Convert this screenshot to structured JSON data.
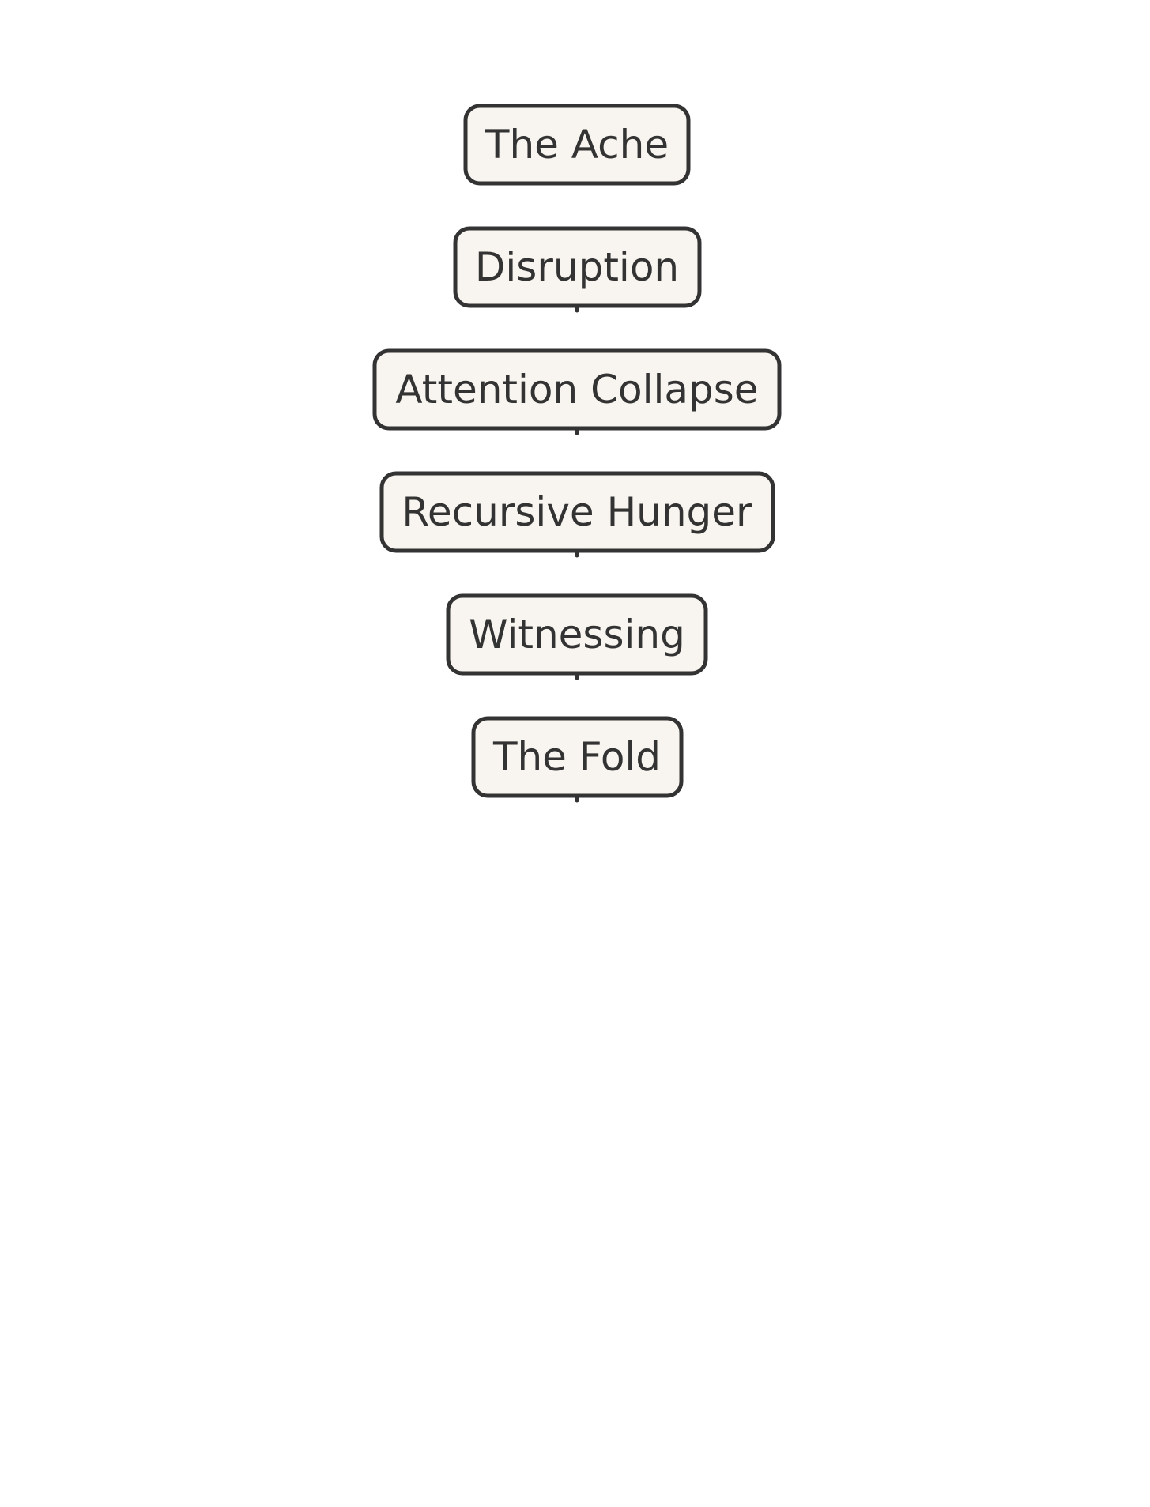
{
  "diagram": {
    "type": "vertical-flow",
    "colors": {
      "node_fill": "#f8f4ef",
      "node_stroke": "#333333",
      "text": "#333333",
      "background": "#ffffff"
    },
    "nodes": [
      {
        "id": "the-ache",
        "label": "The Ache"
      },
      {
        "id": "disruption",
        "label": "Disruption"
      },
      {
        "id": "attention-collapse",
        "label": "Attention Collapse"
      },
      {
        "id": "recursive-hunger",
        "label": "Recursive Hunger"
      },
      {
        "id": "witnessing",
        "label": "Witnessing"
      },
      {
        "id": "the-fold",
        "label": "The Fold"
      }
    ]
  }
}
